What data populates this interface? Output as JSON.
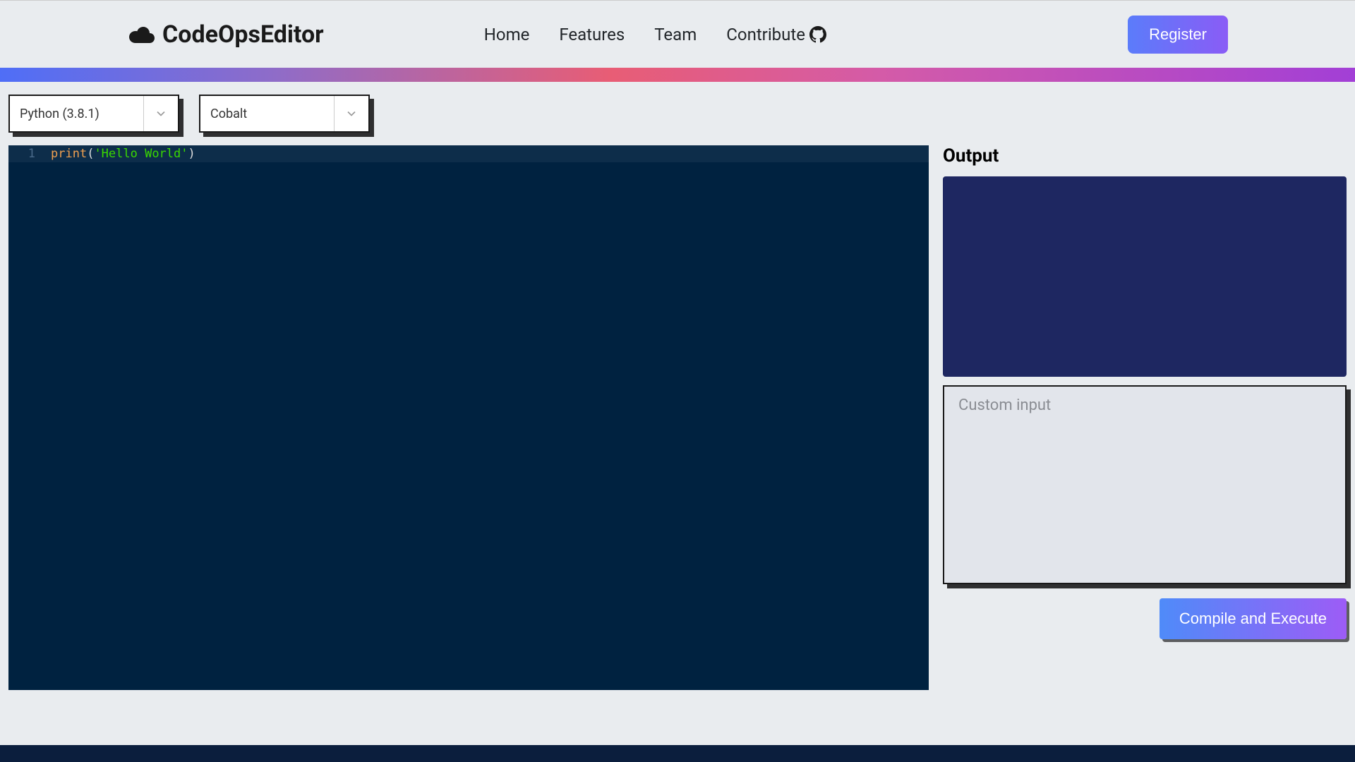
{
  "brand": {
    "name": "CodeOpsEditor"
  },
  "nav": {
    "home": "Home",
    "features": "Features",
    "team": "Team",
    "contribute": "Contribute"
  },
  "register_label": "Register",
  "toolbar": {
    "language_selected": "Python (3.8.1)",
    "theme_selected": "Cobalt"
  },
  "editor": {
    "line_number": "1",
    "code_func": "print",
    "code_open": "(",
    "code_str": "'Hello World'",
    "code_close": ")"
  },
  "right": {
    "output_label": "Output",
    "input_placeholder": "Custom input",
    "compile_label": "Compile and Execute"
  }
}
